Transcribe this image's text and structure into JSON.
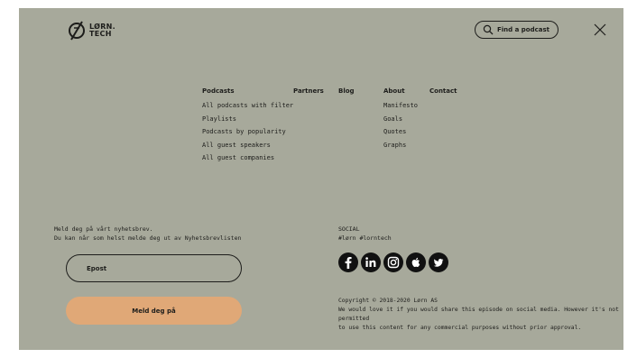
{
  "brand": {
    "logo_text_line1": "LØRN.",
    "logo_text_line2": "TECH"
  },
  "header": {
    "find_label": "Find a podcast"
  },
  "nav": {
    "podcasts": {
      "heading": "Podcasts",
      "items": [
        "All podcasts with filter",
        "Playlists",
        "Podcasts by popularity",
        "All guest speakers",
        "All guest companies"
      ]
    },
    "partners": {
      "heading": "Partners"
    },
    "blog": {
      "heading": "Blog"
    },
    "about": {
      "heading": "About",
      "items": [
        "Manifesto",
        "Goals",
        "Quotes",
        "Graphs"
      ]
    },
    "contact": {
      "heading": "Contact"
    }
  },
  "newsletter": {
    "line1": "Meld deg på vårt nyhetsbrev.",
    "line2": "Du kan når som helst melde deg ut av Nyhetsbrevlisten",
    "email_placeholder": "Epost",
    "button_label": "Meld deg på"
  },
  "social": {
    "heading": "SOCIAL",
    "hashtags": "#lørn #lorntech",
    "icons": [
      "facebook-icon",
      "linkedin-icon",
      "instagram-icon",
      "apple-icon",
      "twitter-icon"
    ]
  },
  "copyright": {
    "line1": "Copyright © 2018-2020 Lørn AS",
    "line2": "We would love it if you would share this episode on social media. However it's not permitted",
    "line3": "to use this content for any commercial purposes without prior approval."
  },
  "colors": {
    "panel_bg": "#a7a99b",
    "accent": "#e0a877",
    "text": "#1d1d1b"
  }
}
